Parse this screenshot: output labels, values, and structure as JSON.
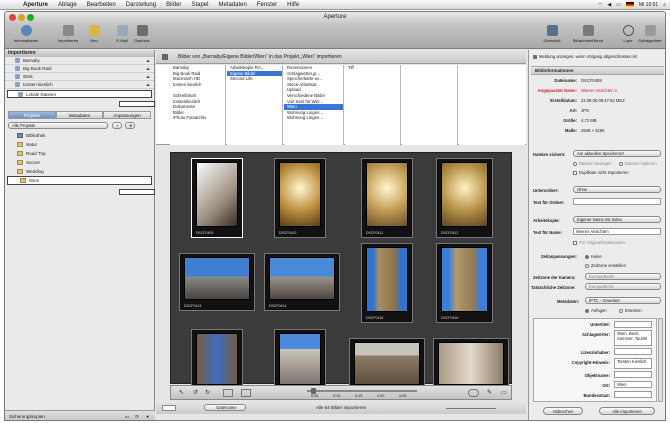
{
  "menubar": {
    "app_name": "Aperture",
    "items": [
      "Ablage",
      "Bearbeiten",
      "Darstellung",
      "Bilder",
      "Stapel",
      "Metadaten",
      "Fenster",
      "Hilfe"
    ],
    "clock": "Mi 10:51"
  },
  "window": {
    "title": "Aperture"
  },
  "toolbar": {
    "left": [
      "Informationen",
      "Importieren",
      "Neu",
      "E-Mail",
      "Diashow"
    ],
    "right": [
      "Übersicht",
      "Bildschirmfüllend",
      "Lupe",
      "Schlagwörter"
    ]
  },
  "sidebar": {
    "import_header": "Importieren",
    "sources": [
      "Barnaby",
      "Big Book Raid",
      "iDisk",
      "torsten kieslich",
      "Lokale Dateien"
    ],
    "tabs": [
      "Projekte",
      "Metadaten",
      "Anpassungen"
    ],
    "project_filter": "Alle Projekte",
    "library": [
      "Bibliothek",
      "Natur",
      "Road Trip",
      "Soccer",
      "Wedding",
      "Wien"
    ],
    "footer": "Sicherungskopien"
  },
  "import_bar": {
    "text": "Bilder von „Barnaby/Eigene Bilder/Wien“ in das Projekt „Wien“ importieren"
  },
  "browser": {
    "col1": [
      "Barnaby",
      "Big Book Raid",
      "Macintosh HD",
      "torsten kieslich",
      "",
      "Schreibtisch",
      "torstenkieslich",
      "Dokumente",
      "Bilder",
      "iPhoto Fotoarchiv"
    ],
    "col2": [
      "Arbeitskopie RA...",
      "Eigene Bilder",
      "Second Life"
    ],
    "col3": [
      "Rezensionen",
      "Schlagwörter.jp...",
      "Speicherkarte wi...",
      "Stock-Arbeitsar...",
      "Upload",
      "Verschiedene Bilder",
      "Von Seel für Wer...",
      "Wien",
      "Wohnung Lingen...",
      "Wohnung Lingen..."
    ],
    "col4": [
      "Tiff"
    ]
  },
  "thumbs": [
    "DSCF0409",
    "DSCF0410",
    "DSCF0411",
    "DSCF0412",
    "DSCF0413",
    "DSCF0414",
    "DSCF0415",
    "DSCF0416",
    "",
    "",
    "",
    "",
    ""
  ],
  "grid_tools": {
    "slider_marks": [
      "0:05",
      "0:10",
      "0:15",
      "0:20",
      "0:25"
    ]
  },
  "status": {
    "text": "Alle 64 Bilder importieren",
    "sort": "Dateiname"
  },
  "rightpanel": {
    "notify": "Meldung anzeigen, wenn Vorgang abgeschlossen ist",
    "info_header": "Bildinformationen",
    "info": [
      {
        "label": "Dateiname:",
        "value": "DSCF0409"
      },
      {
        "label": "Angepasster Name:",
        "value": "Wiener Ansichten 1"
      },
      {
        "label": "Erstelldatum:",
        "value": "22.08.05 09:47:52 MEZ"
      },
      {
        "label": "Art:",
        "value": "JPG"
      },
      {
        "label": "Größe:",
        "value": "4,72 MB"
      },
      {
        "label": "Maße:",
        "value": "2848 × 4256"
      }
    ],
    "store_label": "Dateien sichern:",
    "store_value": "Am aktuellen Speicherort",
    "move_opts": [
      "Dateien bewegen",
      "Dateien kopieren"
    ],
    "no_dupes": "Duplikate nicht importieren",
    "subfolder_label": "Unterordner:",
    "subfolder_value": "Ohne",
    "folder_text_label": "Text für Ordner:",
    "version_label": "Arbeitskopie:",
    "version_value": "Eigener Name mit Index",
    "name_text_label": "Text für Name:",
    "name_text_value": "Wiener Ansichten",
    "original_names": "Für Original-Dateinamen",
    "tz_label": "Zeitanpassungen:",
    "tz_opts": [
      "Keine",
      "Zeitzone einstellen"
    ],
    "cam_tz_label": "Zeitzone der Kamera:",
    "cam_tz_value": "Europa/Berlin",
    "act_tz_label": "Tatsächliche Zeitzone:",
    "act_tz_value": "Europa/Berlin",
    "meta_label": "Metadaten:",
    "meta_value": "IPTC – Erweitert",
    "meta_opts": [
      "Anfügen",
      "Ersetzen"
    ],
    "iptc": [
      {
        "label": "Untertitel:",
        "value": ""
      },
      {
        "label": "Schlagwörter:",
        "value": "Wien, Bach, Sommer, Tourist"
      },
      {
        "label": "Lizenzinhaber:",
        "value": ""
      },
      {
        "label": "Copyright-Hinweis:",
        "value": "Torsten Kieslich"
      },
      {
        "label": "Objektname:",
        "value": ""
      },
      {
        "label": "Ort:",
        "value": "Wien"
      },
      {
        "label": "Bundesstaat:",
        "value": ""
      }
    ],
    "cancel": "Abbrechen",
    "import_all": "Alle importieren"
  }
}
